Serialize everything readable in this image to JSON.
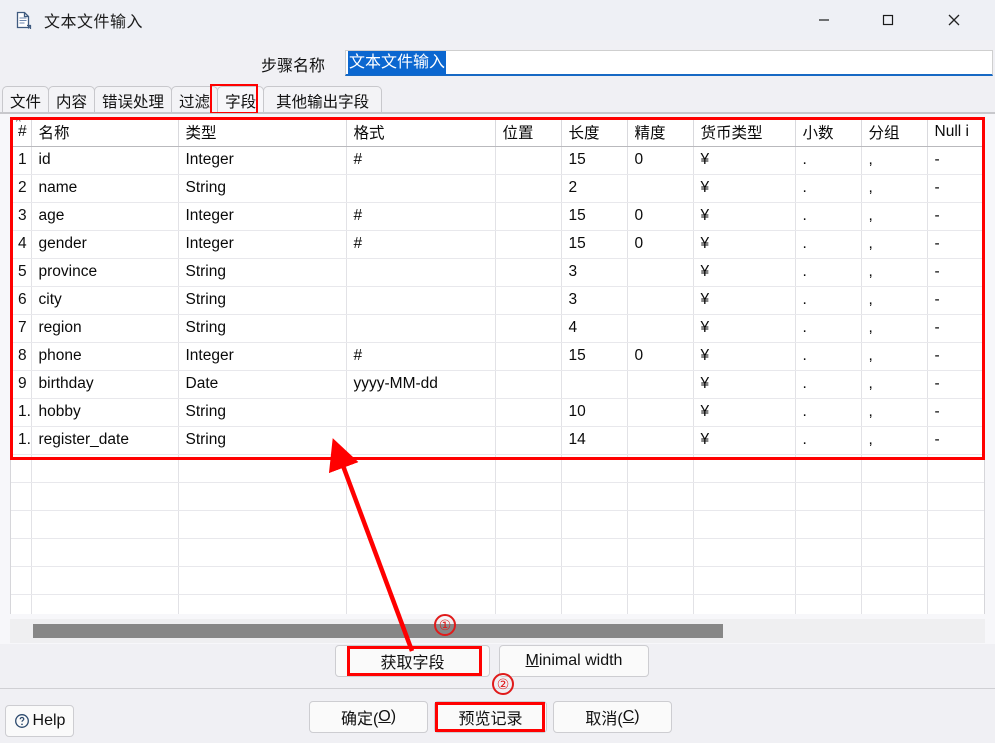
{
  "window": {
    "title": "文本文件输入",
    "icon": "text-file-input-icon",
    "minimize_label": "—",
    "maximize_label": "▢",
    "close_label": "✕"
  },
  "step": {
    "label": "步骤名称",
    "value": "文本文件输入",
    "selected": true
  },
  "tabs": [
    {
      "label": "文件",
      "selected": false
    },
    {
      "label": "内容",
      "selected": false
    },
    {
      "label": "错误处理",
      "selected": false
    },
    {
      "label": "过滤",
      "selected": false
    },
    {
      "label": "字段",
      "selected": true
    },
    {
      "label": "其他输出字段",
      "selected": false
    }
  ],
  "table": {
    "columns": [
      "#",
      "名称",
      "类型",
      "格式",
      "位置",
      "长度",
      "精度",
      "货币类型",
      "小数",
      "分组",
      "Null i"
    ],
    "sort_indicator": "^",
    "rows": [
      {
        "num": "1",
        "name": "id",
        "type": "Integer",
        "format": "#",
        "position": "",
        "length": "15",
        "precision": "0",
        "currency": "¥",
        "decimal": ".",
        "group": ",",
        "nullif": "-"
      },
      {
        "num": "2",
        "name": "name",
        "type": "String",
        "format": "",
        "position": "",
        "length": "2",
        "precision": "",
        "currency": "¥",
        "decimal": ".",
        "group": ",",
        "nullif": "-"
      },
      {
        "num": "3",
        "name": "age",
        "type": "Integer",
        "format": "#",
        "position": "",
        "length": "15",
        "precision": "0",
        "currency": "¥",
        "decimal": ".",
        "group": ",",
        "nullif": "-"
      },
      {
        "num": "4",
        "name": "gender",
        "type": "Integer",
        "format": "#",
        "position": "",
        "length": "15",
        "precision": "0",
        "currency": "¥",
        "decimal": ".",
        "group": ",",
        "nullif": "-"
      },
      {
        "num": "5",
        "name": "province",
        "type": "String",
        "format": "",
        "position": "",
        "length": "3",
        "precision": "",
        "currency": "¥",
        "decimal": ".",
        "group": ",",
        "nullif": "-"
      },
      {
        "num": "6",
        "name": "city",
        "type": "String",
        "format": "",
        "position": "",
        "length": "3",
        "precision": "",
        "currency": "¥",
        "decimal": ".",
        "group": ",",
        "nullif": "-"
      },
      {
        "num": "7",
        "name": "region",
        "type": "String",
        "format": "",
        "position": "",
        "length": "4",
        "precision": "",
        "currency": "¥",
        "decimal": ".",
        "group": ",",
        "nullif": "-"
      },
      {
        "num": "8",
        "name": "phone",
        "type": "Integer",
        "format": "#",
        "position": "",
        "length": "15",
        "precision": "0",
        "currency": "¥",
        "decimal": ".",
        "group": ",",
        "nullif": "-"
      },
      {
        "num": "9",
        "name": "birthday",
        "type": "Date",
        "format": "yyyy-MM-dd",
        "position": "",
        "length": "",
        "precision": "",
        "currency": "¥",
        "decimal": ".",
        "group": ",",
        "nullif": "-"
      },
      {
        "num": "1.",
        "name": "hobby",
        "type": "String",
        "format": "",
        "position": "",
        "length": "10",
        "precision": "",
        "currency": "¥",
        "decimal": ".",
        "group": ",",
        "nullif": "-"
      },
      {
        "num": "1.",
        "name": "register_date",
        "type": "String",
        "format": "",
        "position": "",
        "length": "14",
        "precision": "",
        "currency": "¥",
        "decimal": ".",
        "group": ",",
        "nullif": "-"
      }
    ],
    "empty_row_count": 6
  },
  "buttons": {
    "get_fields": "获取字段",
    "minimal_width_prefix": "M",
    "minimal_width_rest": "inimal width",
    "help": "Help",
    "ok_prefix": "确定(",
    "ok_mnemonic": "O",
    "ok_suffix": ")",
    "preview": "预览记录",
    "cancel_prefix": "取消(",
    "cancel_mnemonic": "C",
    "cancel_suffix": ")"
  },
  "annotations": {
    "marker_1": "①",
    "marker_2": "②",
    "highlight_color": "#ff0000"
  }
}
